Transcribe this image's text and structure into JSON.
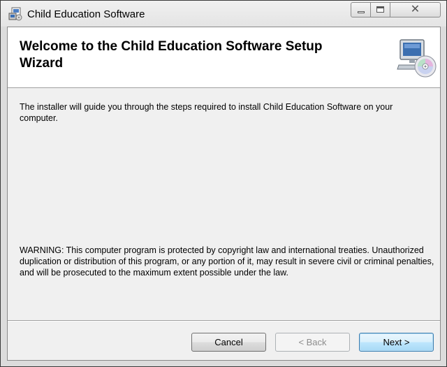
{
  "window": {
    "title": "Child Education Software",
    "close_glyph": "✕"
  },
  "banner": {
    "title": "Welcome to the Child Education Software Setup Wizard",
    "icon": "computer-cd-icon"
  },
  "content": {
    "intro": "The installer will guide you through the steps required to install Child Education Software on your computer.",
    "warning": "WARNING: This computer program is protected by copyright law and international treaties. Unauthorized duplication or distribution of this program, or any portion of it, may result in severe civil or criminal penalties, and will be prosecuted to the maximum extent possible under the law."
  },
  "buttons": {
    "cancel": "Cancel",
    "back": "< Back",
    "next": "Next >"
  },
  "colors": {
    "dialog_background": "#f0f0f0",
    "banner_background": "#ffffff",
    "next_button_border": "#3c7fb1"
  }
}
